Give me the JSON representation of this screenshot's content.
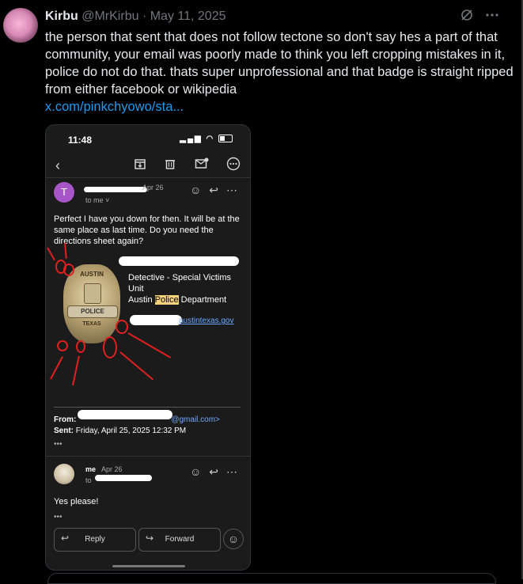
{
  "tweet": {
    "author_name": "Kirbu",
    "author_handle": "@MrKirbu",
    "separator": "·",
    "date": "May 11, 2025",
    "text": "the person that sent that does not follow tectone so don't say hes a part of that community, your email was poorly made to think you left cropping mistakes in it, police do not do that. thats super unprofessional and that badge is straight ripped from either facebook or wikipedia",
    "link": "x.com/pinkchyowo/sta...",
    "icons": [
      "grok-icon",
      "more-icon"
    ]
  },
  "screenshot": {
    "status_time": "11:48",
    "first_email": {
      "avatar_letter": "T",
      "date": "Apr 26",
      "to": "to me ˅",
      "body": "Perfect I have you down for then. It will be at the same place as last time. Do you need the directions sheet again?",
      "badge_text": {
        "top": "AUSTIN",
        "band": "POLICE",
        "bottom": "TEXAS"
      },
      "signature": {
        "line1": "Detective - Special Victims",
        "line2": "Unit",
        "dept_prefix": "Austin ",
        "dept_highlight": "Police",
        "dept_suffix": " Department",
        "email_domain": "austintexas.gov"
      },
      "quoted": {
        "from_label": "From:",
        "from_domain": "@gmail.com>",
        "sent_label": "Sent:",
        "sent_value": "Friday, April 25, 2025 12:32 PM",
        "more": "•••"
      }
    },
    "reply_email": {
      "sender": "me",
      "date": "Apr 26",
      "to": "to",
      "body": "Yes please!",
      "more": "•••"
    },
    "buttons": {
      "reply": "Reply",
      "forward": "Forward"
    }
  }
}
